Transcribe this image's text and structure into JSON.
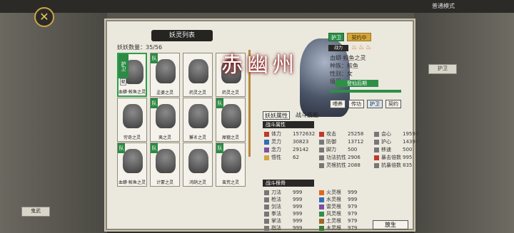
{
  "title": "妖灵列表",
  "count": "妖妖数量：35/56",
  "top_right": "普通模式",
  "side_cards": [
    {
      "text": "鬼武"
    },
    {
      "text": "护卫"
    }
  ],
  "cards": [
    {
      "name": "血蟒·鲛鱼之灵",
      "tag": "护卫",
      "tag2": "契",
      "sel": true
    },
    {
      "name": "孟婆之灵",
      "tag": "队"
    },
    {
      "name": "药灵之灵",
      "tag": ""
    },
    {
      "name": "药灵之灵",
      "tag": ""
    },
    {
      "name": "穷奇之灵",
      "tag": ""
    },
    {
      "name": "夷之灵",
      "tag": "队"
    },
    {
      "name": "獬豸之灵",
      "tag": ""
    },
    {
      "name": "犀貔之灵",
      "tag": "队"
    },
    {
      "name": "血蟒·鲛鱼之灵",
      "tag": "队"
    },
    {
      "name": "计蒙之灵",
      "tag": "队"
    },
    {
      "name": "鸿鹄之灵",
      "tag": ""
    },
    {
      "name": "蛮荒之灵",
      "tag": "队"
    }
  ],
  "boss_name": "赤幽州",
  "badge1": "护卫",
  "badge2": "契约中",
  "power_label": "战力",
  "info_title": "血蟒·鲛鱼之灵",
  "race": "种族：鲛鱼",
  "gender": "性别：女",
  "realm_label": "境界：",
  "realm": "登仙后期",
  "actions": [
    "喂养",
    "传功",
    "护卫",
    "契约"
  ],
  "tab1": "妖妖属性",
  "tab2": "战斗技能",
  "sec1": "战斗属性",
  "sec2": "战斗根骨",
  "stats1": [
    [
      "体力",
      "1572632",
      "#c0392b"
    ],
    [
      "攻击",
      "25258",
      "#c0392b"
    ],
    [
      "会心",
      "19593",
      "#777"
    ],
    [
      "灵力",
      "30823",
      "#2e6fb5"
    ],
    [
      "防御",
      "13712",
      "#777"
    ],
    [
      "护心",
      "14397",
      "#777"
    ],
    [
      "念力",
      "29142",
      "#7d4fa6"
    ],
    [
      "脚力",
      "500",
      "#777"
    ],
    [
      "移速",
      "500",
      "#777"
    ],
    [
      "悟性",
      "62",
      "#d4a63a"
    ],
    [
      "功法抗性",
      "2906",
      "#777"
    ],
    [
      "暴击倍数",
      "995",
      "#c0392b"
    ],
    [
      "",
      "",
      ""
    ],
    [
      "灵根抗性",
      "2088",
      "#777"
    ],
    [
      "抗暴倍数",
      "835",
      "#777"
    ]
  ],
  "stats2": [
    [
      "刀法",
      "999",
      "#777"
    ],
    [
      "火灵根",
      "999",
      "#e2661b"
    ],
    [
      "枪法",
      "999",
      "#777"
    ],
    [
      "水灵根",
      "999",
      "#2e6fb5"
    ],
    [
      "剑法",
      "999",
      "#777"
    ],
    [
      "雷灵根",
      "979",
      "#7d4fa6"
    ],
    [
      "拳法",
      "999",
      "#777"
    ],
    [
      "风灵根",
      "979",
      "#2e8f47"
    ],
    [
      "掌法",
      "999",
      "#777"
    ],
    [
      "土灵根",
      "979",
      "#a0652a"
    ],
    [
      "指法",
      "999",
      "#777"
    ],
    [
      "木灵根",
      "979",
      "#3a7d2e"
    ]
  ],
  "release": "放生"
}
